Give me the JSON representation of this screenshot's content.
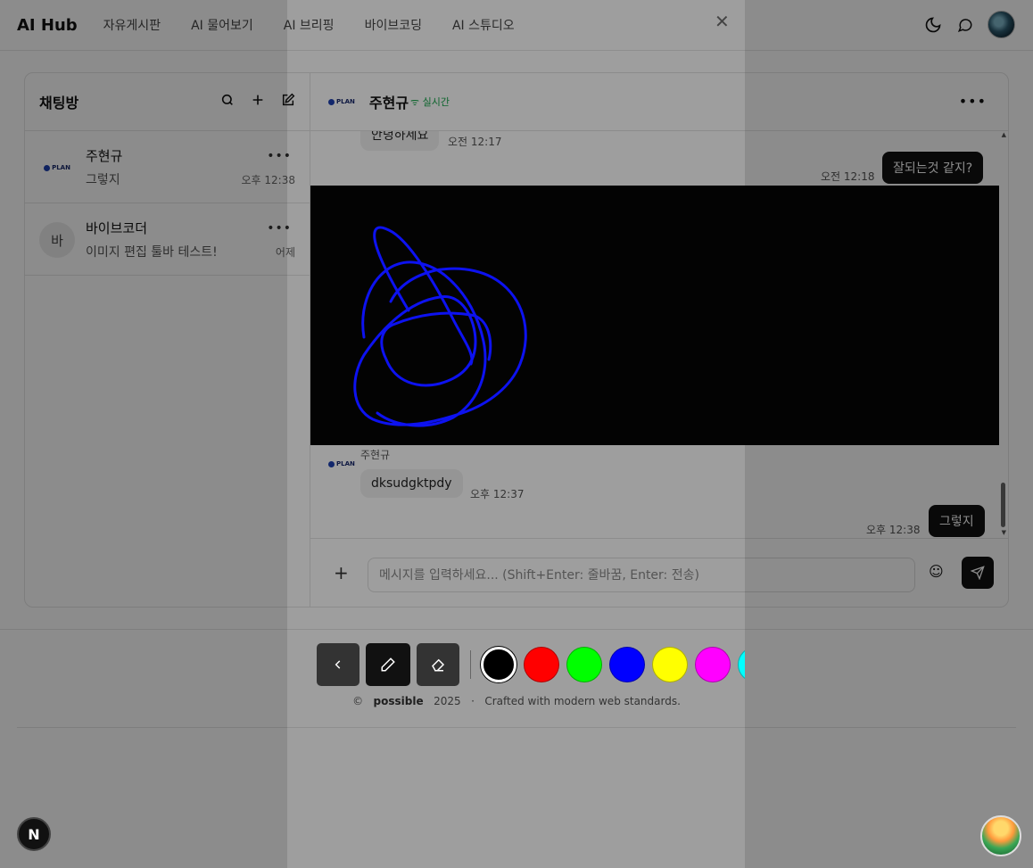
{
  "header": {
    "brand": "AI Hub",
    "nav": [
      "자유게시판",
      "AI 물어보기",
      "AI 브리핑",
      "바이브코딩",
      "AI 스튜디오"
    ]
  },
  "sidebar": {
    "title": "채팅방",
    "rooms": [
      {
        "name": "주현규",
        "last_message": "그렇지",
        "time": "오후 12:38",
        "avatar": "PLAN"
      },
      {
        "name": "바이브코더",
        "last_message": "이미지 편집 툴바 테스트!",
        "time": "어제",
        "avatar": "바"
      }
    ]
  },
  "chat": {
    "name": "주현규",
    "status": "실시간",
    "avatar": "PLAN",
    "messages": [
      {
        "text": "안녕하세요",
        "time": "오전 12:17"
      },
      {
        "text": "잘되는것 같지?",
        "time": "오전 12:18"
      },
      {
        "sender": "주현규",
        "text": "dksudgktpdy",
        "time": "오후 12:37"
      },
      {
        "text": "그렇지",
        "time": "오후 12:38"
      }
    ],
    "input_placeholder": "메시지를 입력하세요... (Shift+Enter: 줄바꿈, Enter: 전송)"
  },
  "footer": {
    "copyright_symbol": "©",
    "brand": "possible",
    "year": "2025",
    "separator": "·",
    "tagline": "Crafted with modern web standards."
  },
  "editor": {
    "colors": [
      "#000000",
      "#ff0000",
      "#00ff00",
      "#0000ff",
      "#ffff00",
      "#ff00ff",
      "#00ffff"
    ],
    "selected_color": "#000000",
    "active_tool": "pen",
    "stroke_color": "#0000ff",
    "brush_color": "#0d12f0"
  },
  "badges": {
    "next": "N"
  }
}
